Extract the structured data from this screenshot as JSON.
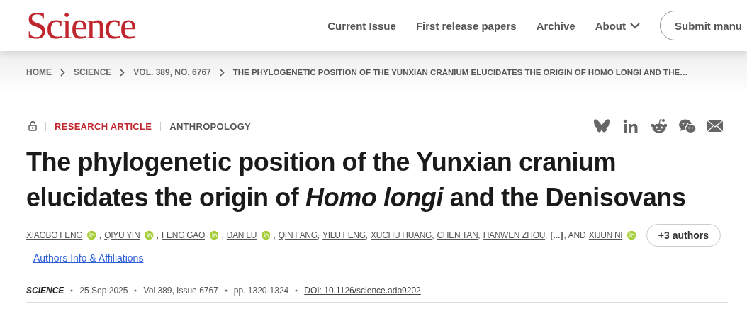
{
  "header": {
    "logo": "Science",
    "nav": [
      {
        "label": "Current Issue",
        "kind": "link"
      },
      {
        "label": "First release papers",
        "kind": "link"
      },
      {
        "label": "Archive",
        "kind": "link"
      },
      {
        "label": "About",
        "kind": "menu"
      },
      {
        "label": "Submit manu",
        "kind": "button"
      }
    ]
  },
  "breadcrumb": [
    "HOME",
    "SCIENCE",
    "VOL. 389, NO. 6767",
    "THE PHYLOGENETIC POSITION OF THE YUNXIAN CRANIUM ELUCIDATES THE ORIGIN OF HOMO LONGI AND THE…"
  ],
  "article": {
    "open_access": true,
    "type": "RESEARCH ARTICLE",
    "subject": "ANTHROPOLOGY",
    "title": "The phylogenetic position of the Yunxian cranium elucidates the origin of *Homo longi* and the Denisovans",
    "authors": [
      {
        "kind": "author",
        "text": "XIAOBO FENG",
        "orcid": true
      },
      {
        "kind": "separator",
        "text": ","
      },
      {
        "kind": "author",
        "text": "QIYU YIN",
        "orcid": true
      },
      {
        "kind": "separator",
        "text": ","
      },
      {
        "kind": "author",
        "text": "FENG GAO",
        "orcid": true
      },
      {
        "kind": "separator",
        "text": ","
      },
      {
        "kind": "author",
        "text": "DAN LU",
        "orcid": true
      },
      {
        "kind": "separator",
        "text": ","
      },
      {
        "kind": "author",
        "text": "QIN FANG",
        "orcid": false
      },
      {
        "kind": "separator",
        "text": ","
      },
      {
        "kind": "author",
        "text": "YILU FENG",
        "orcid": false
      },
      {
        "kind": "separator",
        "text": ","
      },
      {
        "kind": "author",
        "text": "XUCHU HUANG",
        "orcid": false
      },
      {
        "kind": "separator",
        "text": ","
      },
      {
        "kind": "author",
        "text": "CHEN TAN",
        "orcid": false
      },
      {
        "kind": "separator",
        "text": ","
      },
      {
        "kind": "author",
        "text": "HANWEN ZHOU",
        "orcid": false
      },
      {
        "kind": "separator",
        "text": ","
      },
      {
        "kind": "more",
        "text": "[...]"
      },
      {
        "kind": "separator",
        "text": ", AND"
      },
      {
        "kind": "author",
        "text": "XIJUN NI",
        "orcid": true
      }
    ],
    "more_authors": "+3 authors",
    "affiliations_link": "Authors Info & Affiliations",
    "meta": {
      "journal": "SCIENCE",
      "date": "25 Sep 2025",
      "volume": "Vol 389, Issue 6767",
      "pages": "pp. 1320-1324",
      "doi": "DOI: 10.1126/science.ado9202"
    }
  }
}
